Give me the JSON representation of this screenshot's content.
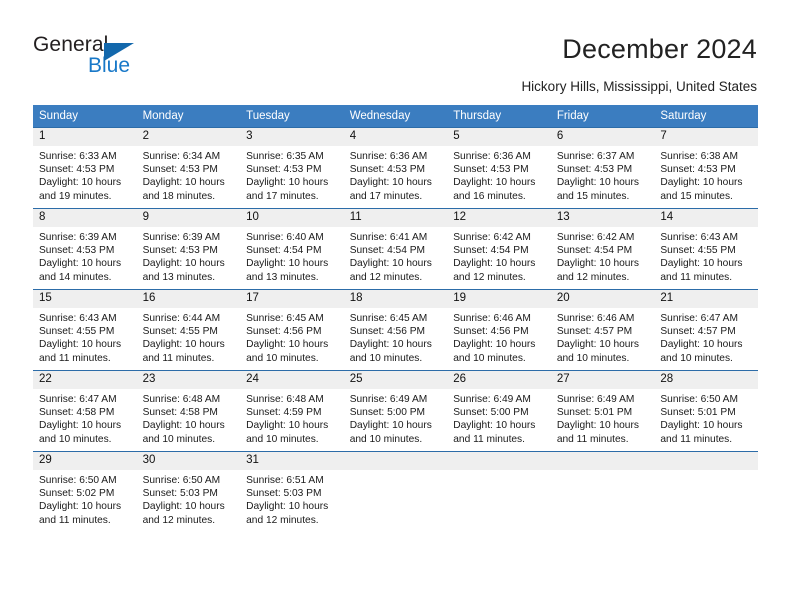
{
  "brand": {
    "word_one": "General",
    "word_two": "Blue",
    "triangle_icon": "triangle-logo-icon",
    "accent_color": "#1878c8",
    "triangle_color": "#1368ac"
  },
  "header": {
    "title": "December 2024",
    "location": "Hickory Hills, Mississippi, United States"
  },
  "theme": {
    "header_row_bg": "#3b7dc0",
    "header_row_text": "#ffffff",
    "daynum_band_bg": "#efefef",
    "row_divider": "#2c6ca8",
    "cell_bg": "#ffffff"
  },
  "weekday_headers": [
    "Sunday",
    "Monday",
    "Tuesday",
    "Wednesday",
    "Thursday",
    "Friday",
    "Saturday"
  ],
  "labels": {
    "sunrise_prefix": "Sunrise:",
    "sunset_prefix": "Sunset:",
    "daylight_prefix": "Daylight:"
  },
  "weeks": [
    [
      {
        "day": "1",
        "sunrise": "Sunrise: 6:33 AM",
        "sunset": "Sunset: 4:53 PM",
        "daylight_1": "Daylight: 10 hours",
        "daylight_2": "and 19 minutes."
      },
      {
        "day": "2",
        "sunrise": "Sunrise: 6:34 AM",
        "sunset": "Sunset: 4:53 PM",
        "daylight_1": "Daylight: 10 hours",
        "daylight_2": "and 18 minutes."
      },
      {
        "day": "3",
        "sunrise": "Sunrise: 6:35 AM",
        "sunset": "Sunset: 4:53 PM",
        "daylight_1": "Daylight: 10 hours",
        "daylight_2": "and 17 minutes."
      },
      {
        "day": "4",
        "sunrise": "Sunrise: 6:36 AM",
        "sunset": "Sunset: 4:53 PM",
        "daylight_1": "Daylight: 10 hours",
        "daylight_2": "and 17 minutes."
      },
      {
        "day": "5",
        "sunrise": "Sunrise: 6:36 AM",
        "sunset": "Sunset: 4:53 PM",
        "daylight_1": "Daylight: 10 hours",
        "daylight_2": "and 16 minutes."
      },
      {
        "day": "6",
        "sunrise": "Sunrise: 6:37 AM",
        "sunset": "Sunset: 4:53 PM",
        "daylight_1": "Daylight: 10 hours",
        "daylight_2": "and 15 minutes."
      },
      {
        "day": "7",
        "sunrise": "Sunrise: 6:38 AM",
        "sunset": "Sunset: 4:53 PM",
        "daylight_1": "Daylight: 10 hours",
        "daylight_2": "and 15 minutes."
      }
    ],
    [
      {
        "day": "8",
        "sunrise": "Sunrise: 6:39 AM",
        "sunset": "Sunset: 4:53 PM",
        "daylight_1": "Daylight: 10 hours",
        "daylight_2": "and 14 minutes."
      },
      {
        "day": "9",
        "sunrise": "Sunrise: 6:39 AM",
        "sunset": "Sunset: 4:53 PM",
        "daylight_1": "Daylight: 10 hours",
        "daylight_2": "and 13 minutes."
      },
      {
        "day": "10",
        "sunrise": "Sunrise: 6:40 AM",
        "sunset": "Sunset: 4:54 PM",
        "daylight_1": "Daylight: 10 hours",
        "daylight_2": "and 13 minutes."
      },
      {
        "day": "11",
        "sunrise": "Sunrise: 6:41 AM",
        "sunset": "Sunset: 4:54 PM",
        "daylight_1": "Daylight: 10 hours",
        "daylight_2": "and 12 minutes."
      },
      {
        "day": "12",
        "sunrise": "Sunrise: 6:42 AM",
        "sunset": "Sunset: 4:54 PM",
        "daylight_1": "Daylight: 10 hours",
        "daylight_2": "and 12 minutes."
      },
      {
        "day": "13",
        "sunrise": "Sunrise: 6:42 AM",
        "sunset": "Sunset: 4:54 PM",
        "daylight_1": "Daylight: 10 hours",
        "daylight_2": "and 12 minutes."
      },
      {
        "day": "14",
        "sunrise": "Sunrise: 6:43 AM",
        "sunset": "Sunset: 4:55 PM",
        "daylight_1": "Daylight: 10 hours",
        "daylight_2": "and 11 minutes."
      }
    ],
    [
      {
        "day": "15",
        "sunrise": "Sunrise: 6:43 AM",
        "sunset": "Sunset: 4:55 PM",
        "daylight_1": "Daylight: 10 hours",
        "daylight_2": "and 11 minutes."
      },
      {
        "day": "16",
        "sunrise": "Sunrise: 6:44 AM",
        "sunset": "Sunset: 4:55 PM",
        "daylight_1": "Daylight: 10 hours",
        "daylight_2": "and 11 minutes."
      },
      {
        "day": "17",
        "sunrise": "Sunrise: 6:45 AM",
        "sunset": "Sunset: 4:56 PM",
        "daylight_1": "Daylight: 10 hours",
        "daylight_2": "and 10 minutes."
      },
      {
        "day": "18",
        "sunrise": "Sunrise: 6:45 AM",
        "sunset": "Sunset: 4:56 PM",
        "daylight_1": "Daylight: 10 hours",
        "daylight_2": "and 10 minutes."
      },
      {
        "day": "19",
        "sunrise": "Sunrise: 6:46 AM",
        "sunset": "Sunset: 4:56 PM",
        "daylight_1": "Daylight: 10 hours",
        "daylight_2": "and 10 minutes."
      },
      {
        "day": "20",
        "sunrise": "Sunrise: 6:46 AM",
        "sunset": "Sunset: 4:57 PM",
        "daylight_1": "Daylight: 10 hours",
        "daylight_2": "and 10 minutes."
      },
      {
        "day": "21",
        "sunrise": "Sunrise: 6:47 AM",
        "sunset": "Sunset: 4:57 PM",
        "daylight_1": "Daylight: 10 hours",
        "daylight_2": "and 10 minutes."
      }
    ],
    [
      {
        "day": "22",
        "sunrise": "Sunrise: 6:47 AM",
        "sunset": "Sunset: 4:58 PM",
        "daylight_1": "Daylight: 10 hours",
        "daylight_2": "and 10 minutes."
      },
      {
        "day": "23",
        "sunrise": "Sunrise: 6:48 AM",
        "sunset": "Sunset: 4:58 PM",
        "daylight_1": "Daylight: 10 hours",
        "daylight_2": "and 10 minutes."
      },
      {
        "day": "24",
        "sunrise": "Sunrise: 6:48 AM",
        "sunset": "Sunset: 4:59 PM",
        "daylight_1": "Daylight: 10 hours",
        "daylight_2": "and 10 minutes."
      },
      {
        "day": "25",
        "sunrise": "Sunrise: 6:49 AM",
        "sunset": "Sunset: 5:00 PM",
        "daylight_1": "Daylight: 10 hours",
        "daylight_2": "and 10 minutes."
      },
      {
        "day": "26",
        "sunrise": "Sunrise: 6:49 AM",
        "sunset": "Sunset: 5:00 PM",
        "daylight_1": "Daylight: 10 hours",
        "daylight_2": "and 11 minutes."
      },
      {
        "day": "27",
        "sunrise": "Sunrise: 6:49 AM",
        "sunset": "Sunset: 5:01 PM",
        "daylight_1": "Daylight: 10 hours",
        "daylight_2": "and 11 minutes."
      },
      {
        "day": "28",
        "sunrise": "Sunrise: 6:50 AM",
        "sunset": "Sunset: 5:01 PM",
        "daylight_1": "Daylight: 10 hours",
        "daylight_2": "and 11 minutes."
      }
    ],
    [
      {
        "day": "29",
        "sunrise": "Sunrise: 6:50 AM",
        "sunset": "Sunset: 5:02 PM",
        "daylight_1": "Daylight: 10 hours",
        "daylight_2": "and 11 minutes."
      },
      {
        "day": "30",
        "sunrise": "Sunrise: 6:50 AM",
        "sunset": "Sunset: 5:03 PM",
        "daylight_1": "Daylight: 10 hours",
        "daylight_2": "and 12 minutes."
      },
      {
        "day": "31",
        "sunrise": "Sunrise: 6:51 AM",
        "sunset": "Sunset: 5:03 PM",
        "daylight_1": "Daylight: 10 hours",
        "daylight_2": "and 12 minutes."
      },
      {
        "day": "",
        "sunrise": "",
        "sunset": "",
        "daylight_1": "",
        "daylight_2": ""
      },
      {
        "day": "",
        "sunrise": "",
        "sunset": "",
        "daylight_1": "",
        "daylight_2": ""
      },
      {
        "day": "",
        "sunrise": "",
        "sunset": "",
        "daylight_1": "",
        "daylight_2": ""
      },
      {
        "day": "",
        "sunrise": "",
        "sunset": "",
        "daylight_1": "",
        "daylight_2": ""
      }
    ]
  ]
}
